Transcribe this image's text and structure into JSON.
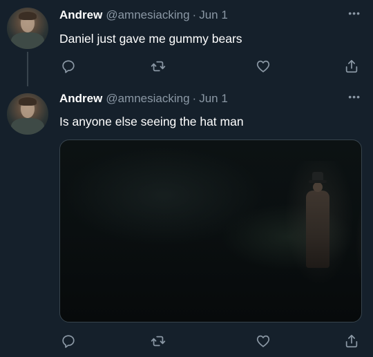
{
  "tweets": [
    {
      "name": "Andrew",
      "handle": "@amnesiacking",
      "separator": "·",
      "date": "Jun 1",
      "text": "Daniel just gave me gummy bears",
      "more": "•••",
      "has_thread_line": true,
      "icons": [
        "reply-icon",
        "retweet-icon",
        "like-icon",
        "share-icon"
      ]
    },
    {
      "name": "Andrew",
      "handle": "@amnesiacking",
      "separator": "·",
      "date": "Jun 1",
      "text": "Is anyone else seeing the hat man",
      "more": "•••",
      "has_media": true,
      "icons": [
        "reply-icon",
        "retweet-icon",
        "like-icon",
        "share-icon"
      ]
    }
  ],
  "colors": {
    "background": "#15202b",
    "primary_text": "#ffffff",
    "secondary_text": "#8b98a5",
    "border": "#38444d"
  }
}
